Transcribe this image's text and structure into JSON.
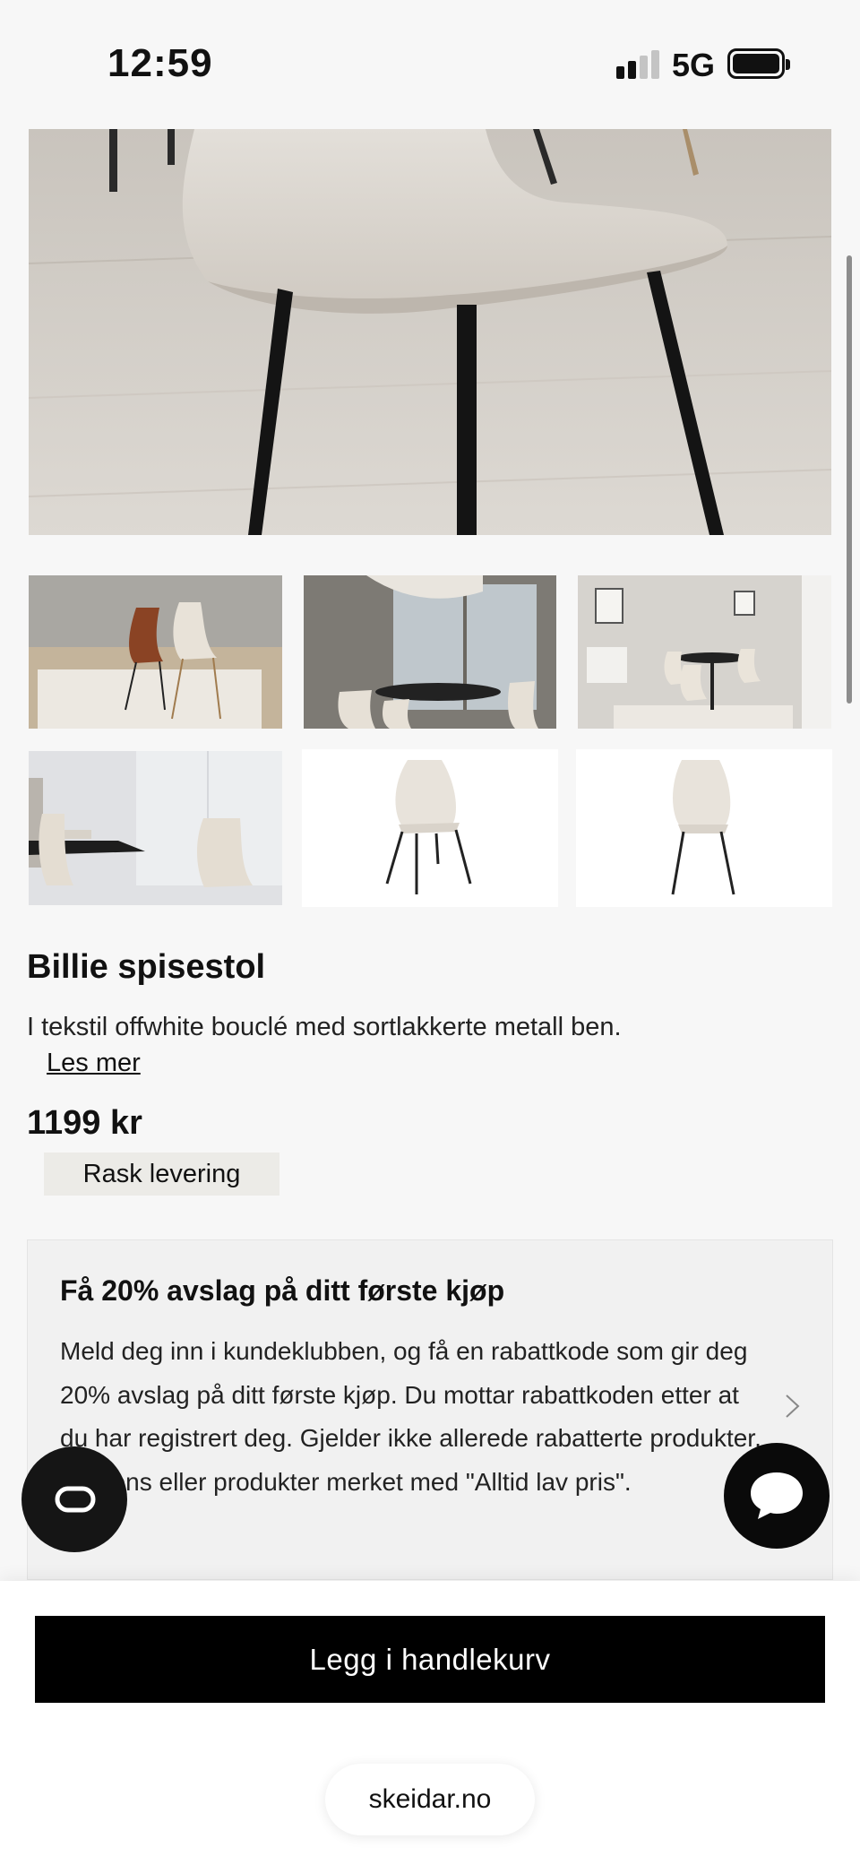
{
  "status_bar": {
    "time": "12:59",
    "network": "5G",
    "signal_icon": "signal-bars-icon",
    "battery_icon": "battery-full-icon"
  },
  "gallery": {
    "hero_image": "chair-closeup-photo",
    "thumbnails": [
      "chairs-rust-and-white-photo",
      "dining-room-window-photo",
      "dining-set-rug-photo",
      "chair-by-table-photo",
      "chair-front-white-background",
      "chair-side-white-background"
    ]
  },
  "product": {
    "title": "Billie spisestol",
    "description": "I tekstil offwhite bouclé med sortlakkerte metall ben.",
    "read_more": "Les mer",
    "price": "1199 kr",
    "delivery_badge": "Rask levering"
  },
  "promo": {
    "title": "Få 20% avslag på ditt første kjøp",
    "body": "Meld deg inn i kundeklubben, og få en rabattkode som gir deg 20% avslag på ditt første kjøp. Du mottar rabattkoden etter at du har registrert deg. Gjelder ikke allerede rabatterte produkter, Hästens eller produkter merket med \"Alltid lav pris\".",
    "chevron_icon": "chevron-right-icon"
  },
  "floating": {
    "cookie_icon": "cookie-consent-icon",
    "chat_icon": "chat-bubble-icon"
  },
  "bottom_bar": {
    "cart_button": "Legg i handlekurv",
    "url": "skeidar.no"
  },
  "colors": {
    "background": "#f7f7f7",
    "primary_button": "#000000",
    "badge_background": "#ecebe7",
    "promo_background": "#f1f1f1"
  }
}
